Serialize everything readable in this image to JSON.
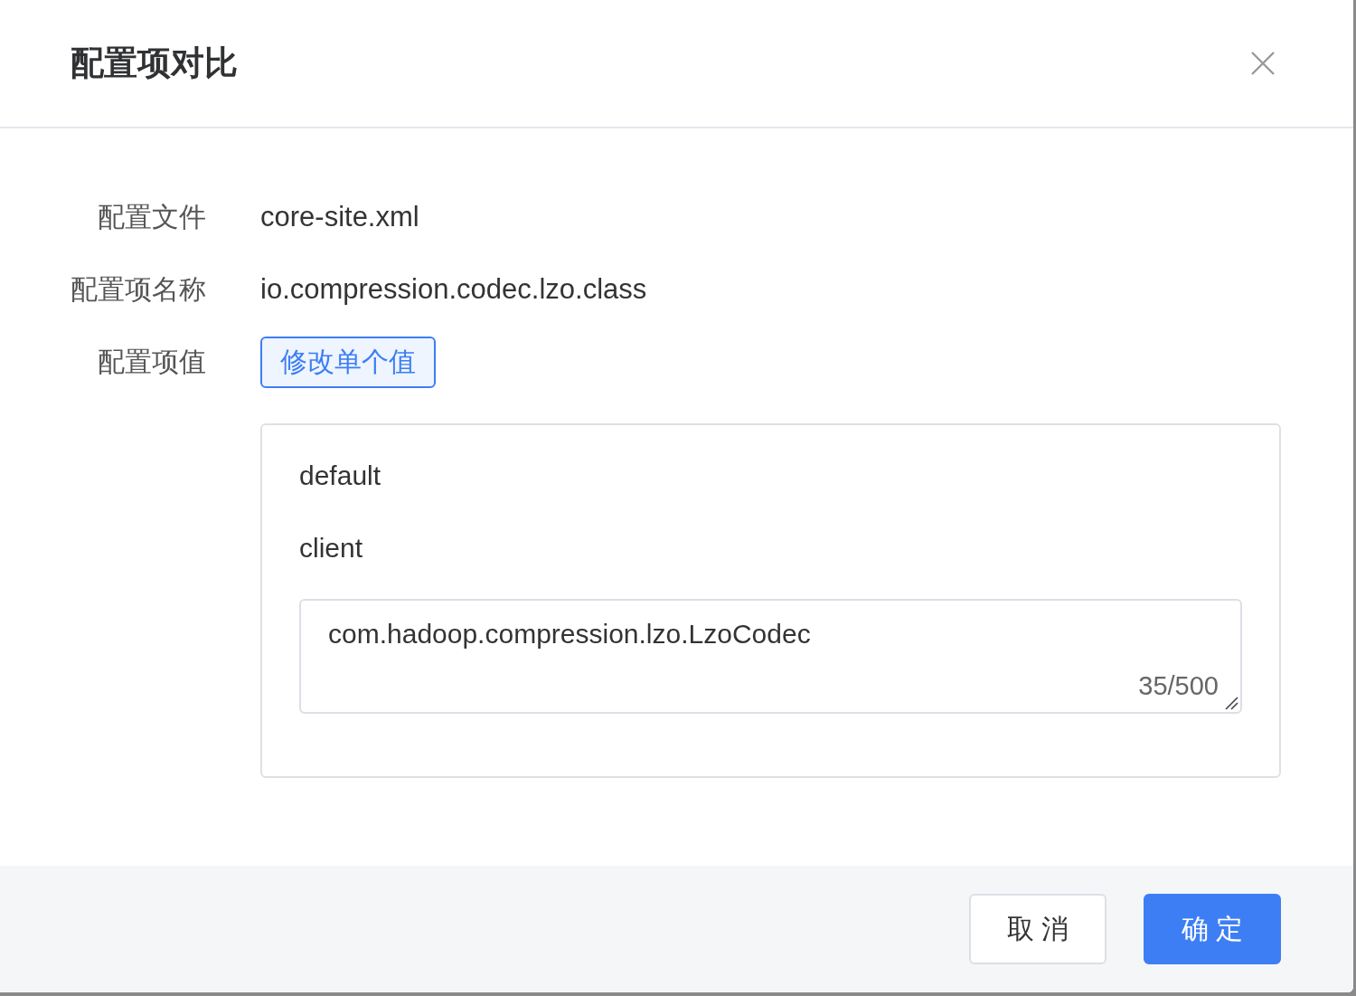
{
  "dialog": {
    "title": "配置项对比"
  },
  "fields": [
    {
      "label": "配置文件",
      "value": "core-site.xml"
    },
    {
      "label": "配置项名称",
      "value": "io.compression.codec.lzo.class"
    }
  ],
  "value_field": {
    "label": "配置项值",
    "mode_button": {
      "label": "修改单个值",
      "selected": true
    }
  },
  "value_panel": {
    "groups": [
      {
        "label": "default"
      },
      {
        "label": "client",
        "textarea": {
          "value": "com.hadoop.compression.lzo.LzoCodec",
          "counter": "35/500"
        }
      }
    ]
  },
  "footer": {
    "buttons": [
      {
        "label": "取 消",
        "kind": "secondary"
      },
      {
        "label": "确 定",
        "kind": "primary"
      }
    ]
  }
}
